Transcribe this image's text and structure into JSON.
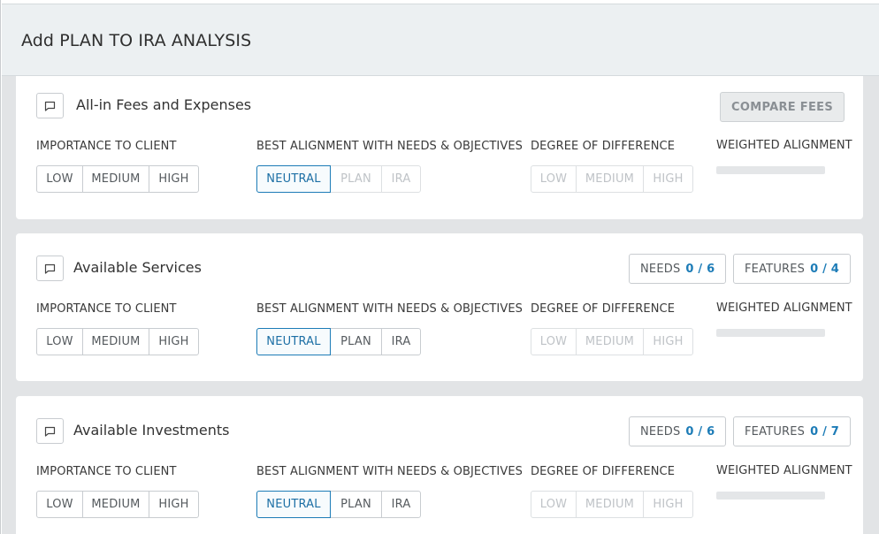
{
  "header": {
    "title": "Add PLAN TO IRA ANALYSIS"
  },
  "labels": {
    "importance": "IMPORTANCE TO CLIENT",
    "alignment": "BEST ALIGNMENT WITH NEEDS & OBJECTIVES",
    "difference": "DEGREE OF DIFFERENCE",
    "weighted": "WEIGHTED ALIGNMENT"
  },
  "options": {
    "importance": [
      "LOW",
      "MEDIUM",
      "HIGH"
    ],
    "alignment": [
      "NEUTRAL",
      "PLAN",
      "IRA"
    ],
    "difference": [
      "LOW",
      "MEDIUM",
      "HIGH"
    ]
  },
  "cards": [
    {
      "title": "All-in Fees and Expenses",
      "compare_label": "COMPARE FEES",
      "alignment_selected": "NEUTRAL",
      "alignment_disabled_others": true,
      "weighted_alignment": 0
    },
    {
      "title": "Available Services",
      "needs_label": "NEEDS",
      "needs_count": "0 / 6",
      "features_label": "FEATURES",
      "features_count": "0 / 4",
      "alignment_selected": "NEUTRAL",
      "alignment_disabled_others": false,
      "weighted_alignment": 0
    },
    {
      "title": "Available Investments",
      "needs_label": "NEEDS",
      "needs_count": "0 / 6",
      "features_label": "FEATURES",
      "features_count": "0 / 7",
      "alignment_selected": "NEUTRAL",
      "alignment_disabled_others": false,
      "weighted_alignment": 0
    }
  ],
  "colors": {
    "accent": "#1d7cb7",
    "header_bg": "#ecf0f2",
    "body_bg": "#e2e4e6"
  }
}
